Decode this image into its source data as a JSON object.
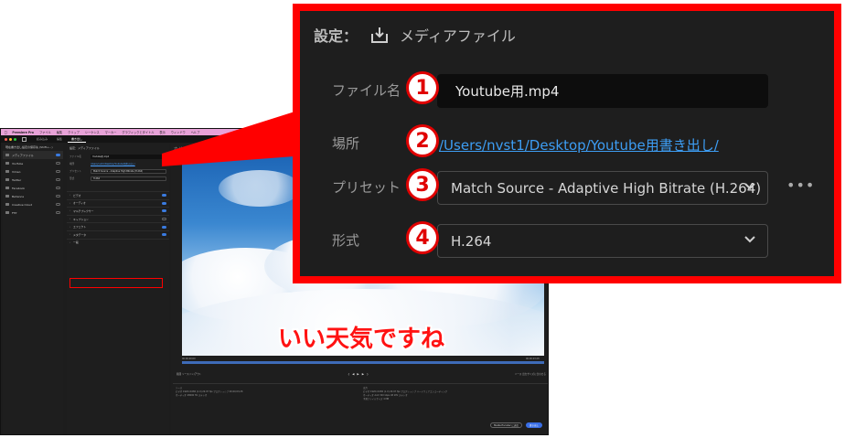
{
  "menubar": {
    "app_name": "Premiere Pro",
    "items": [
      "ファイル",
      "編集",
      "クリップ",
      "シーケンス",
      "マーカー",
      "グラフィックとタイトル",
      "表示",
      "ウィンドウ",
      "ヘルプ"
    ]
  },
  "header_tabs": [
    "読み込み",
    "編集",
    "書き出し"
  ],
  "destinations": {
    "header": "現在書き出し設定の保存先 (Shift+...)",
    "items": [
      {
        "label": "メディアファイル",
        "on": true,
        "active": true
      },
      {
        "label": "YouTube",
        "on": false
      },
      {
        "label": "Vimeo",
        "on": false
      },
      {
        "label": "Twitter",
        "on": false
      },
      {
        "label": "Facebook",
        "on": false
      },
      {
        "label": "Behance",
        "on": false
      },
      {
        "label": "Creative Cloud",
        "on": false
      },
      {
        "label": "FTP",
        "on": false
      }
    ]
  },
  "middle": {
    "title": "設定：メディアファイル",
    "filename_label": "ファイル名",
    "filename": "Youtube用.mp4",
    "location_label": "場所",
    "location": "/Users/nvst1/Desktop/Youtube用書き出し/",
    "preset_label": "プリセット",
    "preset": "Match Source - Adaptive High Bitrate (H.264)",
    "format_label": "形式",
    "format": "H.264",
    "sections": [
      {
        "label": "ビデオ",
        "on": true
      },
      {
        "label": "オーディオ",
        "on": true
      },
      {
        "label": "マルチプレクサー",
        "on": true
      },
      {
        "label": "キャプション",
        "on": false
      },
      {
        "label": "エフェクト",
        "on": true
      },
      {
        "label": "メタデータ",
        "on": true
      },
      {
        "label": "一般",
        "on": null
      }
    ]
  },
  "preview": {
    "title": "プレビュー",
    "caption": "いい天気ですね",
    "tc_start": "00;00;00;00",
    "tc_end": "00;00;03;28",
    "range_label": "範囲",
    "range_value": "ソースイン/アウト",
    "scale_label": "ソース",
    "scale_value": "出力サイズに合わせる",
    "summary_left_title": "ソース",
    "summary_left_lines": [
      "ビデオ 1920×1080 (1.0) 29.97 fps プログレッシブ 00;00;03;28",
      "オーディオ 48000 Hz ステレオ"
    ],
    "summary_right_title": "出力",
    "summary_right_lines": [
      "ビデオ 1920×1080 (1.0) 29.97 fps プログレッシブ ハードウェアエンコーディング",
      "オーディオ AAC 320 kbps 48 kHz ステレオ",
      "予測ファイルサイズ 4 MB"
    ],
    "btn_media_encoder": "Media Encoder に送信",
    "btn_export": "書き出し"
  },
  "zoom": {
    "settings_label": "設定：",
    "media_file": "メディアファイル",
    "rows": [
      {
        "num": "1",
        "label": "ファイル名",
        "value": "Youtube用.mp4",
        "kind": "input"
      },
      {
        "num": "2",
        "label": "場所",
        "value": "/Users/nvst1/Desktop/Youtube用書き出し/",
        "kind": "link"
      },
      {
        "num": "3",
        "label": "プリセット",
        "value": "Match Source - Adaptive High Bitrate (H.264)",
        "kind": "select"
      },
      {
        "num": "4",
        "label": "形式",
        "value": "H.264",
        "kind": "select"
      }
    ],
    "more": "•••"
  },
  "colors": {
    "highlight": "#ff0000",
    "accent": "#3a7be0",
    "link": "#3d9df3",
    "caption": "#ff1212"
  }
}
